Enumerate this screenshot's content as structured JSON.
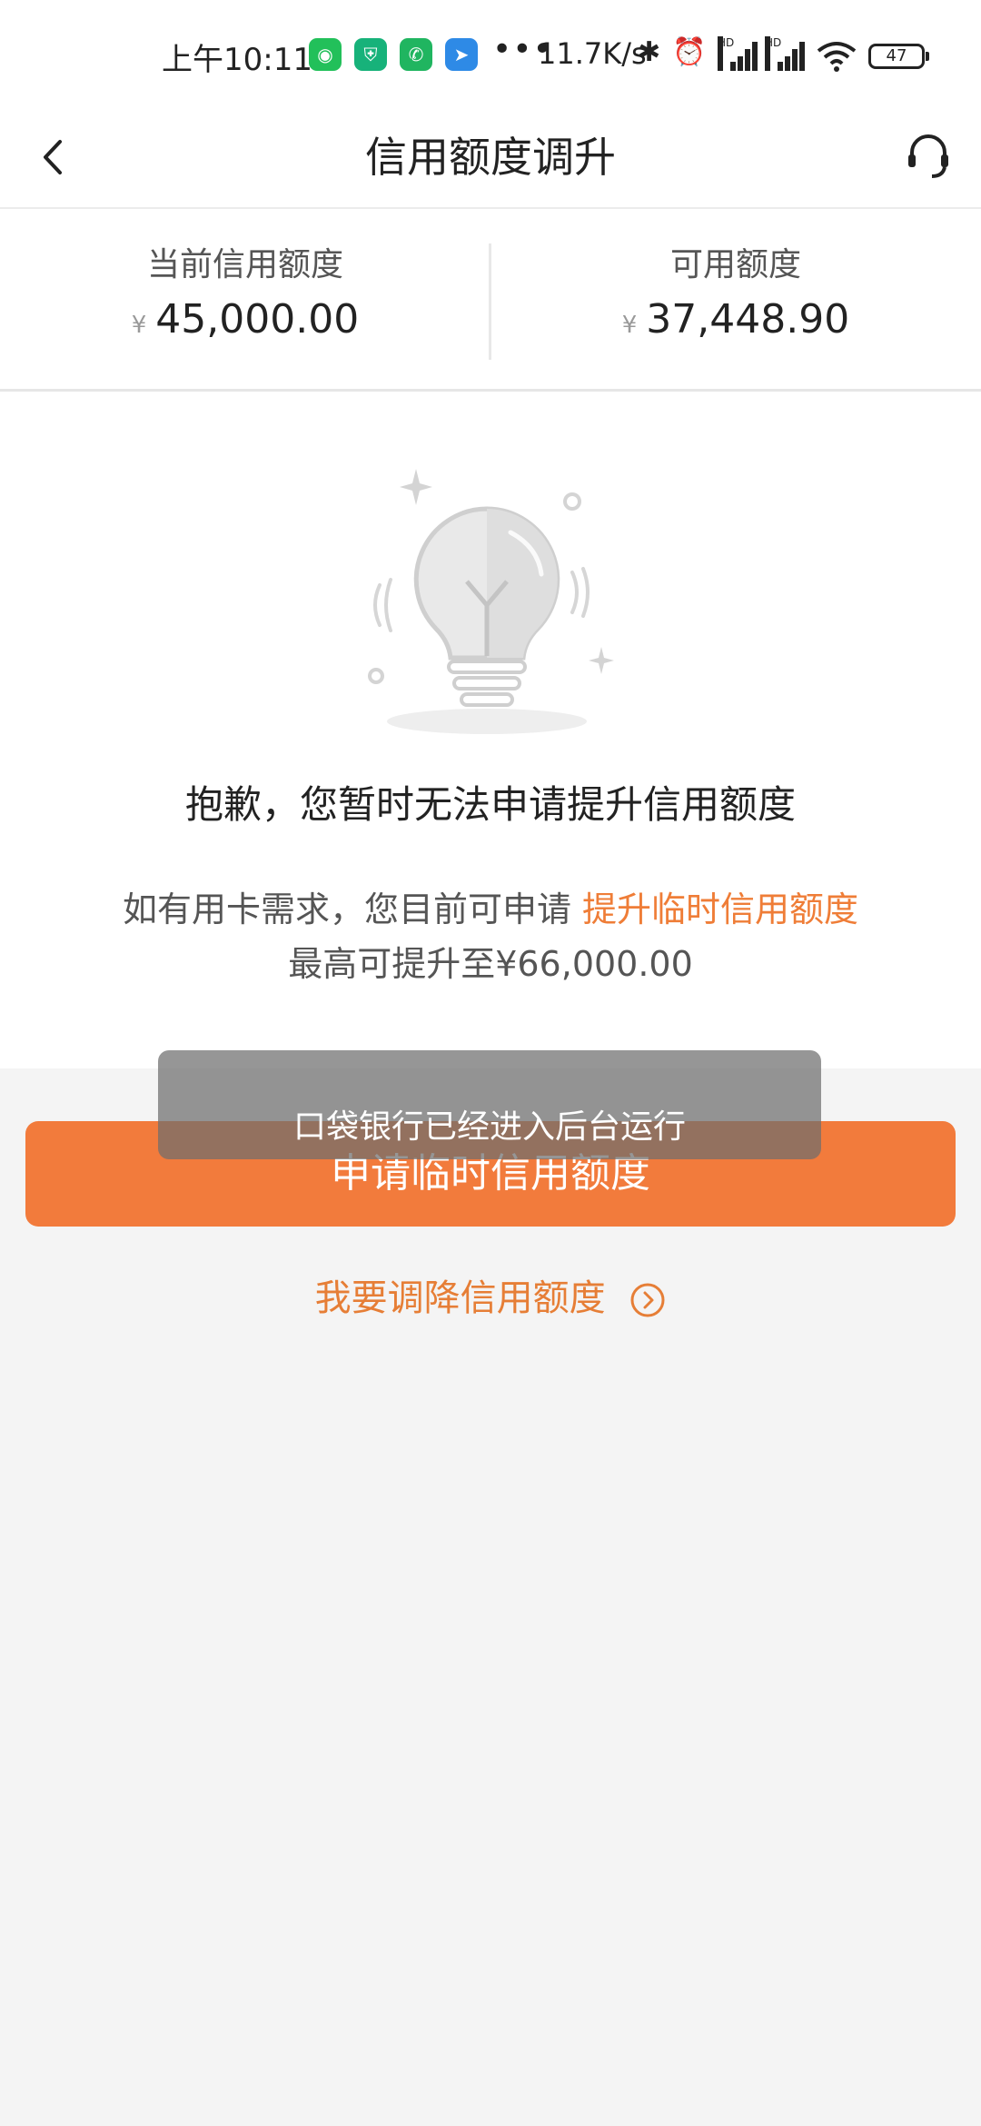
{
  "status_bar": {
    "time": "上午10:11",
    "dots": "•••",
    "net_speed": "11.7K/s",
    "battery": "47",
    "hd1": "HD",
    "hd2": "HD"
  },
  "header": {
    "title": "信用额度调升"
  },
  "amounts": {
    "current": {
      "label": "当前信用额度",
      "currency": "¥",
      "value": "45,000.00"
    },
    "available": {
      "label": "可用额度",
      "currency": "¥",
      "value": "37,448.90"
    }
  },
  "message": "抱歉，您暂时无法申请提升信用额度",
  "hint": {
    "prefix": "如有用卡需求，您目前可申请",
    "link": "提升临时信用额度",
    "line2": "最高可提升至¥66,000.00"
  },
  "apply_button": "申请临时信用额度",
  "toast": "口袋银行已经进入后台运行",
  "reduce_link": "我要调降信用额度",
  "colors": {
    "accent": "#f27b3c",
    "link": "#ef7d37"
  }
}
